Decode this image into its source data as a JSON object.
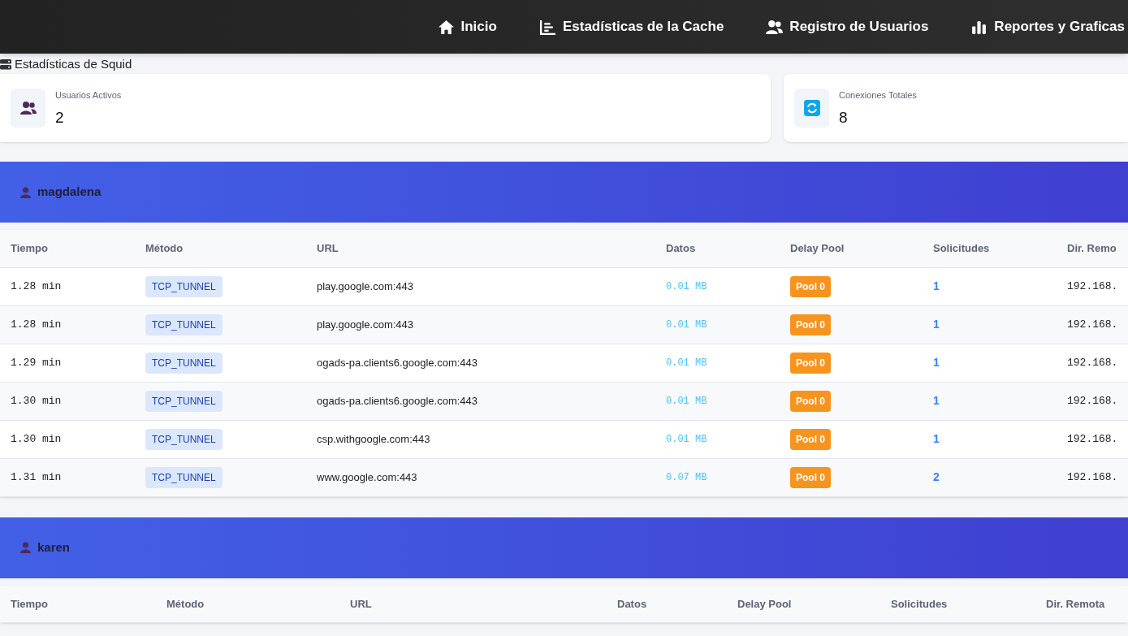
{
  "nav": [
    {
      "label": "Inicio"
    },
    {
      "label": "Estadísticas de la Cache"
    },
    {
      "label": "Registro de Usuarios"
    },
    {
      "label": "Reportes y Graficas"
    }
  ],
  "page_title": "Estadísticas de Squid",
  "stats": [
    {
      "label": "Usuarios Activos",
      "value": "2"
    },
    {
      "label": "Conexiones Totales",
      "value": "8"
    }
  ],
  "users": [
    {
      "name": "magdalena",
      "columns": [
        "Tiempo",
        "Método",
        "URL",
        "Datos",
        "Delay Pool",
        "Solicitudes",
        "Dir. Remo"
      ],
      "rows": [
        {
          "time": "1.28 min",
          "method": "TCP_TUNNEL",
          "url": "play.google.com:443",
          "data": "0.01 MB",
          "pool": "Pool 0",
          "requests": "1",
          "remote": "192.168."
        },
        {
          "time": "1.28 min",
          "method": "TCP_TUNNEL",
          "url": "play.google.com:443",
          "data": "0.01 MB",
          "pool": "Pool 0",
          "requests": "1",
          "remote": "192.168."
        },
        {
          "time": "1.29 min",
          "method": "TCP_TUNNEL",
          "url": "ogads-pa.clients6.google.com:443",
          "data": "0.01 MB",
          "pool": "Pool 0",
          "requests": "1",
          "remote": "192.168."
        },
        {
          "time": "1.30 min",
          "method": "TCP_TUNNEL",
          "url": "ogads-pa.clients6.google.com:443",
          "data": "0.01 MB",
          "pool": "Pool 0",
          "requests": "1",
          "remote": "192.168."
        },
        {
          "time": "1.30 min",
          "method": "TCP_TUNNEL",
          "url": "csp.withgoogle.com:443",
          "data": "0.01 MB",
          "pool": "Pool 0",
          "requests": "1",
          "remote": "192.168."
        },
        {
          "time": "1.31 min",
          "method": "TCP_TUNNEL",
          "url": "www.google.com:443",
          "data": "0.07 MB",
          "pool": "Pool 0",
          "requests": "2",
          "remote": "192.168."
        }
      ]
    },
    {
      "name": "karen",
      "columns": [
        "Tiempo",
        "Método",
        "URL",
        "Datos",
        "Delay Pool",
        "Solicitudes",
        "Dir. Remota"
      ]
    }
  ]
}
